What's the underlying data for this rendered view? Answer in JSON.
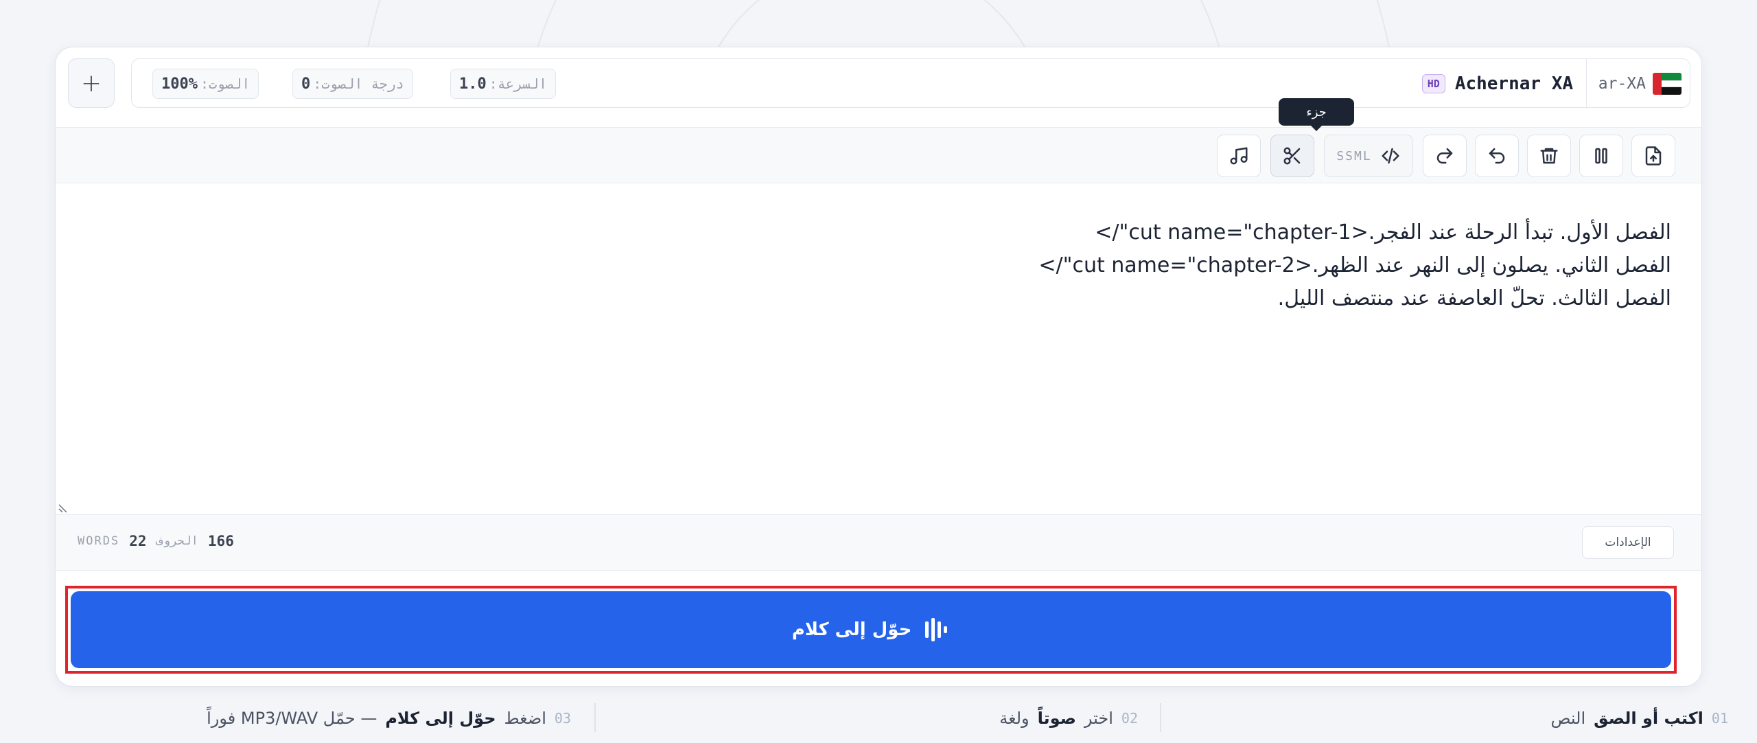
{
  "voice_bar": {
    "add_label": "+",
    "volume": {
      "label": "الصوت:",
      "value": "100%"
    },
    "pitch": {
      "label": "درجة الصوت:",
      "value": "0"
    },
    "speed": {
      "label": "السرعة:",
      "value": "1.0"
    },
    "quality_badge": "HD",
    "voice_name": "Achernar XA",
    "locale": "ar-XA",
    "flag_colors": {
      "red": "#d8262f",
      "green": "#0e8a3c",
      "white": "#ffffff",
      "black": "#121212"
    }
  },
  "toolbar": {
    "ssml_label": "SSML",
    "tooltip": "جزء",
    "icons": [
      "music-icon",
      "scissors-icon",
      "code-icon",
      "redo-icon",
      "undo-icon",
      "trash-icon",
      "pause-icon",
      "upload-file-icon"
    ]
  },
  "editor": {
    "lines": [
      "الفصل الأول. تبدأ الرحلة عند الفجر.<cut name=\"chapter-1\"/>",
      "الفصل الثاني. يصلون إلى النهر عند الظهر.<cut name=\"chapter-2\"/>",
      "الفصل الثالث. تحلّ العاصفة عند منتصف الليل."
    ]
  },
  "stats": {
    "chars_count": "166",
    "chars_label": "الحروف",
    "words_count": "22",
    "words_label": "WORDS",
    "settings_label": "الإعدادات"
  },
  "convert": {
    "label": "حوّل إلى كلام",
    "color": "#2563eb",
    "highlight_color": "#e0242c"
  },
  "steps": [
    {
      "num": "01",
      "bold": "اكتب أو الصق",
      "rest": "النص"
    },
    {
      "num": "02",
      "pre": "اختر",
      "bold": "صوتاً",
      "rest": "ولغة"
    },
    {
      "num": "03",
      "pre": "اضغط",
      "bold": "حوّل إلى كلام",
      "rest": "— حمّل MP3/WAV فوراً"
    }
  ]
}
